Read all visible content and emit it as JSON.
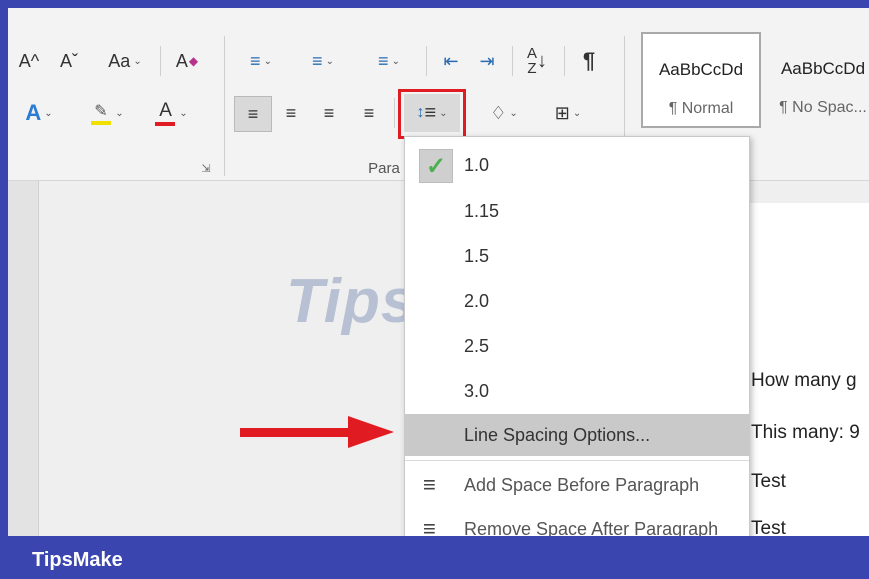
{
  "ribbon": {
    "font_tools": [
      "A^",
      "Aˇ",
      "Aa",
      "A"
    ],
    "para_group_label": "Para",
    "styles": [
      {
        "preview": "AaBbCcDd",
        "label": "¶ Normal"
      },
      {
        "preview": "AaBbCcDd",
        "label": "¶ No Spac..."
      }
    ]
  },
  "menu": {
    "items": [
      "1.0",
      "1.15",
      "1.5",
      "2.0",
      "2.5",
      "3.0",
      "Line Spacing Options...",
      "Add Space Before Paragraph",
      "Remove Space After Paragraph"
    ],
    "checked_index": 0,
    "highlighted_index": 6
  },
  "document": {
    "lines": [
      "How many g",
      "This many: 9",
      "Test",
      "Test"
    ]
  },
  "watermark": "TipsMake",
  "footer": {
    "brand": "TipsMake"
  },
  "colors": {
    "accent": "#3a45b0",
    "highlight_red": "#e01b22",
    "check_green": "#4caf50"
  }
}
